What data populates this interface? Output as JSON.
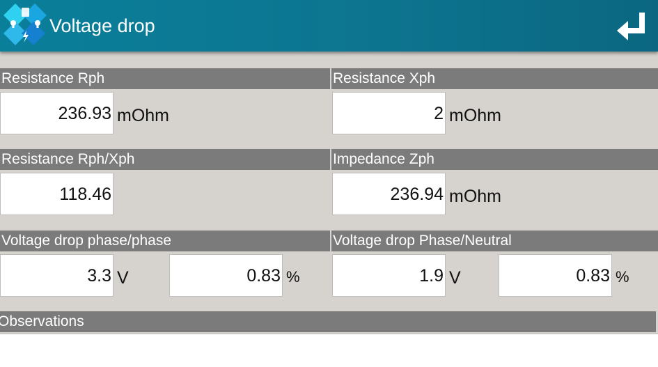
{
  "header": {
    "title": "Voltage drop",
    "app_icon": "calculator-bulb-lightning-icon",
    "back_icon": "return-arrow-icon",
    "accent_color": "#0a7f9a"
  },
  "sections": {
    "resistance_rph": {
      "label": "Resistance Rph",
      "value": "236.93",
      "unit": "mOhm"
    },
    "resistance_xph": {
      "label": "Resistance Xph",
      "value": "2",
      "unit": "mOhm"
    },
    "resistance_ratio": {
      "label": "Resistance Rph/Xph",
      "value": "118.46"
    },
    "impedance_zph": {
      "label": "Impedance Zph",
      "value": "236.94",
      "unit": "mOhm"
    },
    "vdrop_phase_phase": {
      "label": "Voltage drop phase/phase",
      "volt_value": "3.3",
      "volt_unit": "V",
      "percent_value": "0.83",
      "percent_unit": "%"
    },
    "vdrop_phase_neutral": {
      "label": "Voltage drop Phase/Neutral",
      "volt_value": "1.9",
      "volt_unit": "V",
      "percent_value": "0.83",
      "percent_unit": "%"
    },
    "observations": {
      "label": "Observations",
      "value": ""
    }
  }
}
